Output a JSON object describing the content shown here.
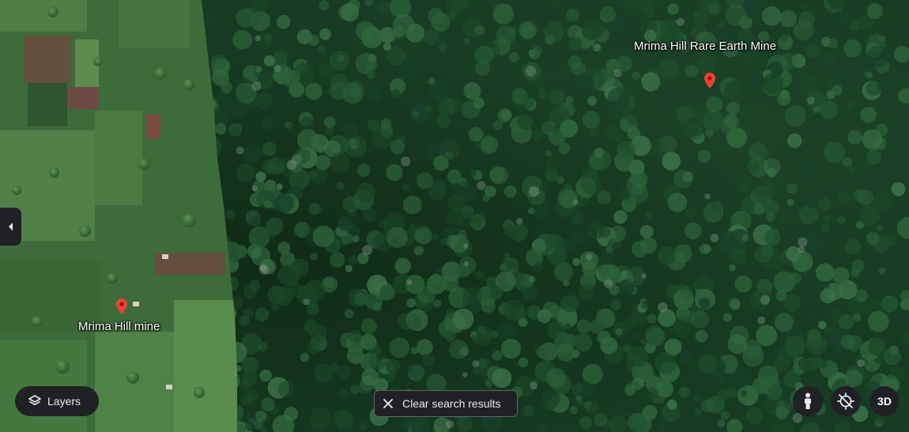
{
  "map": {
    "places": [
      {
        "label": "Mrima Hill Rare Earth Mine",
        "icon": "map-pin-icon"
      },
      {
        "label": "Mrima Hill mine",
        "icon": "map-pin-icon"
      }
    ],
    "pin_color": "#ea4335"
  },
  "controls": {
    "side_panel_toggle_icon": "chevron-left-icon",
    "layers_label": "Layers",
    "layers_icon": "layers-icon",
    "clear_label": "Clear search results",
    "clear_icon": "close-icon",
    "street_view_icon": "pegman-icon",
    "location_icon": "location-disabled-icon",
    "view_3d_label": "3D"
  }
}
